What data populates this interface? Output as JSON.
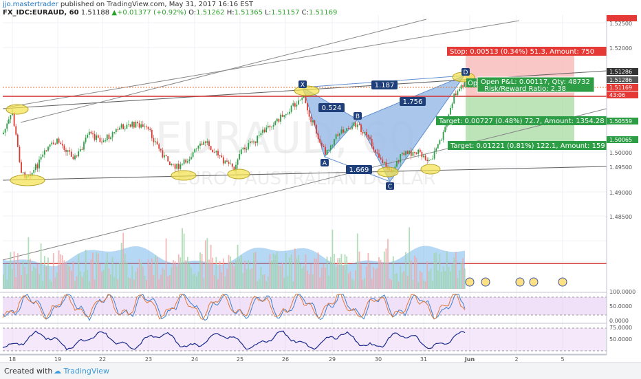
{
  "header": {
    "author": "jjo.mastertrader",
    "published": " published on TradingView.com, May 31, 2017 16:16 EST",
    "symbol": "FX_IDC:EURAUD, 60",
    "last": "1.51188",
    "change": "+0.01377 (+0.92%)",
    "o_label": "O:",
    "o": "1.51262",
    "h_label": "H:",
    "h": "1.51365",
    "l_label": "L:",
    "l": "1.51157",
    "c_label": "C:",
    "c": "1.51169"
  },
  "watermark": {
    "symbol": "EURAUD, 60",
    "name": "EURO / AUSTRALIAN DOLLAR"
  },
  "footer": {
    "created": "Created with",
    "brand": "TradingView"
  },
  "colors": {
    "bull": "#2e9e46",
    "bear": "#d9392f",
    "pattern": "#9bbde8",
    "level": "#d32f2f",
    "stop_zone": "#f8b4b4",
    "target_zone": "#a6dba0",
    "marker": "#f2e14a"
  },
  "chart_data": [
    {
      "type": "candlestick",
      "title": "",
      "xlabel": "",
      "ylabel": "",
      "ylim": [
        1.4825,
        1.5265
      ],
      "grid": true,
      "x_ticks": [
        "18",
        "19",
        "22",
        "23",
        "24",
        "25",
        "26",
        "29",
        "30",
        "31",
        "Jun",
        "2",
        "5"
      ],
      "y_ticks": [
        "1.52500",
        "1.52000",
        "1.50000",
        "1.49500",
        "1.49000",
        "1.48500"
      ],
      "price_labels": [
        "1.51286",
        "1.51286",
        "1.51169",
        "1.50559",
        "1.50065"
      ],
      "countdown": "43:06",
      "current_price": 1.51169,
      "horizontal_level": 1.5097,
      "harmonic_pattern": {
        "points": [
          {
            "label": "X",
            "date": "26",
            "price": 1.5118
          },
          {
            "label": "A",
            "date": "26-29",
            "price": 1.4973
          },
          {
            "label": "B",
            "date": "29",
            "price": 1.5045
          },
          {
            "label": "C",
            "date": "30",
            "price": 1.4932
          },
          {
            "label": "D",
            "date": "31",
            "price": 1.5142
          }
        ],
        "ratios": [
          "0.524",
          "1.187",
          "1.756",
          "1.669"
        ]
      },
      "trade": {
        "stop": "Stop: 0.00513 (0.34%) 51.3, Amount: 750",
        "open_pnl": "Open P&L: 0.00117, Qty: 48732",
        "open_short": "Op",
        "risk_reward": "Risk/Reward Ratio: 2.38",
        "target1": "Target: 0.00727 (0.48%) 72.7, Amount: 1354.28",
        "target2": "Target: 0.01221 (0.81%) 122.1, Amount: 159",
        "entry": 1.5107,
        "stop_price": 1.5163,
        "target1_price": 1.50559,
        "target2_price": 1.50065
      }
    },
    {
      "type": "bar",
      "title": "",
      "series": [
        {
          "values": "volume histogram (approx.)"
        }
      ]
    },
    {
      "type": "line",
      "title": "",
      "y_ticks": [
        "100.0000",
        "50.0000",
        "0.0000"
      ],
      "ylim": [
        -5,
        105
      ],
      "bands": [
        20,
        80
      ]
    },
    {
      "type": "line",
      "title": "",
      "y_ticks": [
        "75.0000",
        "50.0000"
      ],
      "ylim": [
        20,
        85
      ],
      "bands": [
        30,
        70
      ]
    }
  ]
}
